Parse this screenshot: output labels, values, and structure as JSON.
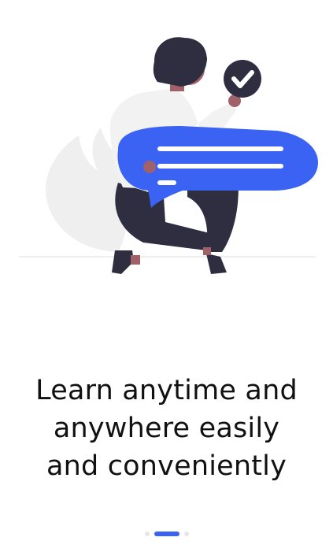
{
  "onboarding": {
    "title_lines": [
      "Learn anytime and",
      "anywhere easily",
      "and conveniently"
    ],
    "page_count": 3,
    "active_page": 2
  },
  "colors": {
    "accent": "#3b63f3",
    "title": "#111111",
    "dot_inactive": "#e6e6e6",
    "figure_dark": "#2f2e41",
    "shirt": "#f2f2f2",
    "skin": "#a0616a"
  },
  "icons": {
    "check_badge": "check-circle-icon"
  }
}
